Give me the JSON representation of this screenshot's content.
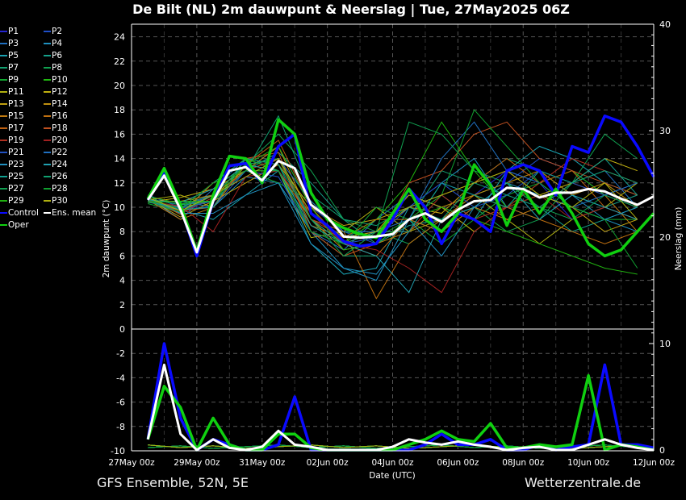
{
  "title": "De Bilt  (NL)  2m dauwpunt & Neerslag | Tue, 27May2025 06Z",
  "footer": {
    "left": "GFS Ensemble, 52N, 5E",
    "right": "Wetterzentrale.de"
  },
  "chart_data": {
    "type": "line",
    "title": "De Bilt  (NL)  2m dauwpunt & Neerslag | Tue, 27May2025 06Z",
    "xlabel": "Date (UTC)",
    "ylabel": "2m dauwpunt (°C)",
    "y2label": "Neerslag (mm)",
    "x_unit": "days since 27May 00z",
    "xlim": [
      0,
      16
    ],
    "ylim": [
      -10,
      25
    ],
    "y2lim": [
      0,
      40
    ],
    "x_ticks": [
      {
        "t": 0,
        "label": "27May 00z"
      },
      {
        "t": 2,
        "label": "29May 00z"
      },
      {
        "t": 4,
        "label": "31May 00z"
      },
      {
        "t": 6,
        "label": "02Jun 00z"
      },
      {
        "t": 8,
        "label": "04Jun 00z"
      },
      {
        "t": 10,
        "label": "06Jun 00z"
      },
      {
        "t": 12,
        "label": "08Jun 00z"
      },
      {
        "t": 14,
        "label": "10Jun 00z"
      },
      {
        "t": 16,
        "label": "12Jun 00z"
      }
    ],
    "y_ticks": [
      "24",
      "22",
      "20",
      "18",
      "16",
      "14",
      "12",
      "10",
      "8",
      "6",
      "4",
      "2",
      "0",
      "-2",
      "-4",
      "-6",
      "-8",
      "-10"
    ],
    "y2_ticks": [
      "40",
      "30",
      "20",
      "10",
      "0"
    ],
    "grid": true,
    "legend_placement": "left",
    "main_x": [
      0.5,
      1,
      1.5,
      2,
      2.5,
      3,
      3.5,
      4,
      4.5,
      5,
      5.5,
      6,
      6.5,
      7,
      7.5,
      8,
      8.5,
      9,
      9.5,
      10,
      10.5,
      11,
      11.5,
      12,
      12.5,
      13,
      13.5,
      14,
      14.5,
      15,
      15.5,
      16
    ],
    "main_series": [
      {
        "name": "Control",
        "color": "#0a0aff",
        "width": 3.5,
        "dewpoint": [
          10.6,
          12.8,
          10,
          6,
          10.5,
          13.4,
          13.6,
          12,
          15,
          16,
          9.5,
          8.5,
          7.2,
          6.8,
          7,
          9,
          11.5,
          10,
          7,
          9.5,
          9,
          8,
          13,
          13.5,
          13,
          11,
          15,
          14.5,
          17.5,
          17,
          15,
          12.5
        ],
        "precip": [
          1,
          10,
          3,
          0,
          1,
          0.5,
          0,
          0,
          0.5,
          5,
          0,
          0,
          0,
          0,
          0,
          0,
          0,
          0.5,
          1.5,
          0.5,
          0.5,
          1,
          0,
          0,
          0.5,
          0,
          0.3,
          0.5,
          8,
          0.5,
          0.5,
          0.2
        ]
      },
      {
        "name": "Oper",
        "color": "#10d010",
        "width": 3.5,
        "dewpoint": [
          10.7,
          13.2,
          10.2,
          6.4,
          11,
          14.2,
          14,
          12,
          17.2,
          16,
          11.2,
          9,
          8.3,
          7.8,
          7.5,
          9.5,
          11.5,
          9,
          8,
          9.5,
          13.5,
          11.8,
          8.5,
          11.5,
          9.5,
          11.5,
          9.5,
          7,
          6,
          6.5,
          8,
          9.5
        ],
        "precip": [
          1,
          6,
          4,
          0,
          3,
          0.5,
          0,
          0,
          1.5,
          1.5,
          0.2,
          0,
          0,
          0,
          0,
          0,
          0.5,
          1,
          1.8,
          1,
          0.8,
          2.5,
          0.2,
          0.2,
          0.5,
          0.3,
          0.5,
          7,
          0,
          0.5,
          0.3,
          0
        ]
      },
      {
        "name": "Ens. mean",
        "color": "#ffffff",
        "width": 3,
        "dewpoint": [
          10.6,
          12.6,
          9.8,
          6.3,
          10.5,
          13,
          13.3,
          12.2,
          13.8,
          13.2,
          10.2,
          9.2,
          7.6,
          7.5,
          7.6,
          7.8,
          9,
          9.5,
          8.8,
          9.8,
          10.5,
          10.6,
          11.6,
          11.5,
          10.8,
          11.2,
          11.2,
          11.5,
          11.3,
          10.7,
          10.2,
          10.9
        ],
        "precip": [
          1,
          8,
          1.5,
          0,
          1,
          0.2,
          0,
          0.3,
          1.8,
          0.5,
          0.3,
          0,
          0,
          0,
          0,
          0.3,
          1,
          0.7,
          0.5,
          0.8,
          0.5,
          0.3,
          0,
          0.2,
          0.3,
          0,
          0,
          0.5,
          1,
          0.5,
          0.2,
          0
        ]
      }
    ],
    "member_x": [
      0.5,
      1.5,
      2.5,
      3.5,
      4.5,
      5.5,
      6.5,
      7.5,
      8.5,
      9.5,
      10.5,
      11.5,
      12.5,
      13.5,
      14.5,
      15.5
    ],
    "members": [
      {
        "name": "P1",
        "color": "#2424d0",
        "dewpoint": [
          10.5,
          9.5,
          11,
          13.5,
          14,
          9,
          7,
          8,
          10,
          12,
          11,
          13,
          12,
          9,
          10,
          11
        ]
      },
      {
        "name": "P2",
        "color": "#1f4fc8",
        "dewpoint": [
          11,
          10,
          10,
          13,
          15,
          10,
          8,
          7,
          9,
          8,
          10,
          12,
          14,
          13,
          11,
          12
        ]
      },
      {
        "name": "P3",
        "color": "#1f6fc0",
        "dewpoint": [
          10.8,
          9,
          11.5,
          14,
          13,
          8,
          6.5,
          9,
          11,
          10,
          9,
          11,
          10,
          12,
          13,
          10
        ]
      },
      {
        "name": "P4",
        "color": "#1f90c0",
        "dewpoint": [
          10.4,
          10.5,
          10,
          12.5,
          12,
          8,
          5,
          4.5,
          8,
          12,
          14,
          10,
          9,
          11,
          9,
          8
        ]
      },
      {
        "name": "P5",
        "color": "#19a0b0",
        "dewpoint": [
          10.6,
          9.8,
          9,
          11,
          13,
          7,
          4.5,
          5,
          10,
          11,
          9,
          13,
          15,
          14,
          12,
          11
        ]
      },
      {
        "name": "P6",
        "color": "#15a08a",
        "dewpoint": [
          10.7,
          10.2,
          11,
          13,
          14.5,
          12,
          9,
          7,
          8.5,
          9,
          11,
          12,
          10,
          8,
          9,
          10
        ]
      },
      {
        "name": "P7",
        "color": "#13a070",
        "dewpoint": [
          11,
          9.5,
          12,
          14,
          13.5,
          8,
          6,
          6,
          9,
          13,
          12,
          14,
          13,
          11,
          10,
          11
        ]
      },
      {
        "name": "P8",
        "color": "#10a050",
        "dewpoint": [
          10.5,
          10,
          10.5,
          13.5,
          16,
          13,
          9,
          8,
          7,
          9,
          10,
          8,
          9,
          12,
          16,
          14
        ]
      },
      {
        "name": "P9",
        "color": "#10a830",
        "dewpoint": [
          10.3,
          9.6,
          11,
          13,
          12,
          10.5,
          8,
          7.5,
          9,
          7,
          9,
          11,
          12,
          10,
          9,
          9
        ]
      },
      {
        "name": "P10",
        "color": "#20b810",
        "dewpoint": [
          10.9,
          10.3,
          10.5,
          14,
          13,
          9.5,
          7,
          9,
          12,
          17,
          13,
          10,
          12,
          13,
          11,
          10
        ]
      },
      {
        "name": "P11",
        "color": "#b0b010",
        "dewpoint": [
          10.6,
          11,
          10,
          13.5,
          13,
          7.5,
          8,
          10,
          8,
          9,
          11,
          9,
          7,
          9,
          10,
          12
        ]
      },
      {
        "name": "P12",
        "color": "#c0b010",
        "dewpoint": [
          10.4,
          10.8,
          11.5,
          13,
          14,
          9,
          7,
          8,
          11,
          10,
          8,
          10,
          11,
          12,
          14,
          13
        ]
      },
      {
        "name": "P13",
        "color": "#c0a010",
        "dewpoint": [
          10.7,
          9.2,
          10.5,
          12,
          13.5,
          10,
          8.5,
          9,
          10,
          9.5,
          12,
          13,
          11,
          10,
          8,
          9
        ]
      },
      {
        "name": "P14",
        "color": "#c09010",
        "dewpoint": [
          10.5,
          10.5,
          11,
          13,
          15,
          9,
          6.5,
          7,
          8,
          10,
          11,
          12,
          13,
          11,
          12,
          10
        ]
      },
      {
        "name": "P15",
        "color": "#c07a10",
        "dewpoint": [
          10.6,
          9,
          10,
          13.5,
          14,
          8.5,
          7.5,
          9,
          9,
          8,
          10,
          9,
          10,
          12,
          11,
          8
        ]
      },
      {
        "name": "P16",
        "color": "#c07010",
        "dewpoint": [
          10.8,
          9.4,
          12,
          13,
          13,
          9,
          8,
          2.5,
          7,
          9,
          11,
          10,
          9,
          8,
          7,
          8
        ]
      },
      {
        "name": "P17",
        "color": "#c06010",
        "dewpoint": [
          10.5,
          10,
          11,
          13.5,
          15.5,
          10,
          7,
          6,
          9,
          11,
          12,
          14,
          12,
          13,
          10,
          9
        ]
      },
      {
        "name": "P18",
        "color": "#c05020",
        "dewpoint": [
          10.6,
          9.7,
          10,
          14,
          14.5,
          8,
          6,
          7,
          12,
          13,
          16,
          17,
          14,
          13,
          12,
          11
        ]
      },
      {
        "name": "P19",
        "color": "#b03020",
        "dewpoint": [
          10.7,
          9.5,
          10.8,
          13,
          14,
          9,
          7.5,
          8,
          8,
          11,
          9,
          10,
          12,
          14,
          13,
          12
        ]
      },
      {
        "name": "P20",
        "color": "#a02020",
        "dewpoint": [
          10.5,
          10.1,
          8,
          12.5,
          13,
          9.5,
          7,
          6.5,
          5,
          3,
          8,
          10,
          11,
          9,
          10,
          9
        ]
      },
      {
        "name": "P21",
        "color": "#2050c0",
        "dewpoint": [
          10.6,
          9.9,
          10.5,
          13,
          12.5,
          8,
          7,
          7.5,
          10,
          12,
          10,
          11,
          13,
          12,
          11,
          10
        ]
      },
      {
        "name": "P22",
        "color": "#2070c0",
        "dewpoint": [
          10.4,
          10,
          11,
          13.5,
          14,
          10.5,
          8,
          8,
          9,
          14,
          17,
          13,
          12,
          10,
          11,
          12
        ]
      },
      {
        "name": "P23",
        "color": "#2090c0",
        "dewpoint": [
          10.8,
          9.5,
          9.5,
          11,
          12,
          7,
          5,
          4,
          9,
          6,
          10,
          12,
          11,
          10,
          9,
          10
        ]
      },
      {
        "name": "P24",
        "color": "#20a0b0",
        "dewpoint": [
          10.6,
          10.4,
          11.5,
          13.5,
          13,
          8.5,
          7,
          6,
          3,
          9,
          10,
          12,
          9,
          11,
          10,
          9
        ]
      },
      {
        "name": "P25",
        "color": "#10a090",
        "dewpoint": [
          10.5,
          9.8,
          10,
          14,
          13.5,
          9,
          7,
          8,
          8,
          12,
          11,
          10,
          13,
          12,
          14,
          11
        ]
      },
      {
        "name": "P26",
        "color": "#10a070",
        "dewpoint": [
          10.7,
          10.2,
          10.5,
          13,
          17.5,
          11,
          9,
          8.5,
          10,
          9,
          12,
          11,
          10,
          12,
          13,
          12
        ]
      },
      {
        "name": "P27",
        "color": "#10a050",
        "dewpoint": [
          10.5,
          9.6,
          11,
          13.5,
          14,
          9,
          6,
          8,
          17,
          16,
          13,
          12,
          10,
          9,
          11,
          10
        ]
      },
      {
        "name": "P28",
        "color": "#10a030",
        "dewpoint": [
          10.6,
          9.9,
          12,
          13,
          13,
          8,
          7,
          10,
          9,
          11,
          18,
          15,
          12,
          10,
          9,
          5
        ]
      },
      {
        "name": "P29",
        "color": "#20b010",
        "dewpoint": [
          10.4,
          10.5,
          10.5,
          13.5,
          15,
          10,
          6.5,
          7,
          9,
          10,
          9,
          8,
          7,
          6,
          5,
          4.5
        ]
      },
      {
        "name": "P30",
        "color": "#b0b010",
        "dewpoint": [
          10.8,
          9.7,
          11,
          12.5,
          14,
          9.5,
          7.5,
          8,
          10,
          11,
          12,
          13,
          11,
          10,
          12,
          9
        ]
      }
    ]
  }
}
